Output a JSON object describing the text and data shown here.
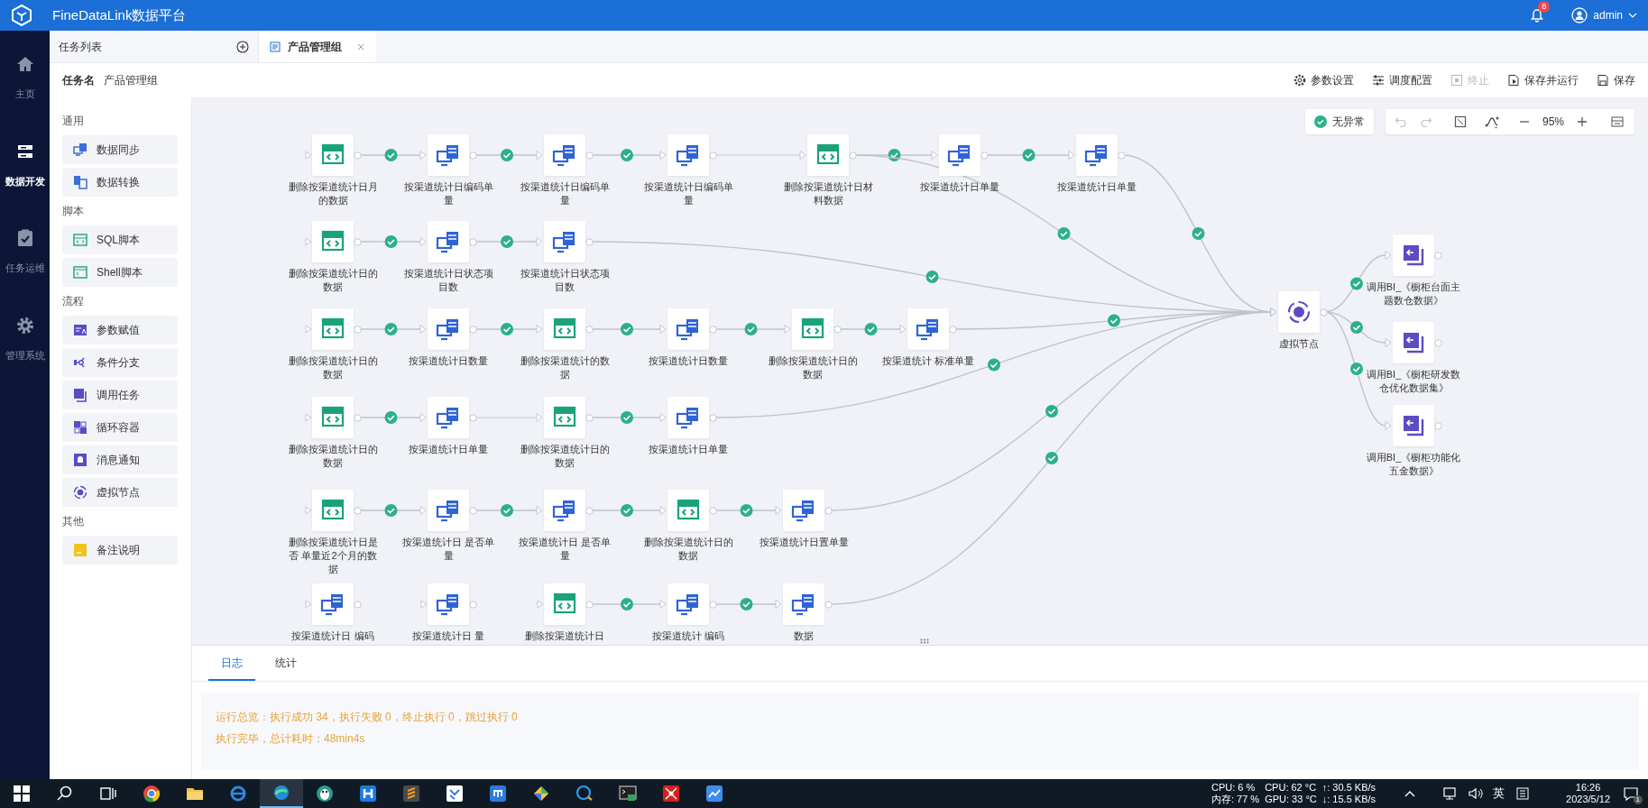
{
  "header": {
    "title": "FineDataLink数据平台",
    "notification_count": "8",
    "user": "admin"
  },
  "nav": [
    {
      "label": "主页",
      "kind": "home",
      "selected": false
    },
    {
      "label": "数据开发",
      "kind": "dev",
      "selected": true
    },
    {
      "label": "任务运维",
      "kind": "ops",
      "selected": false
    },
    {
      "label": "管理系统",
      "kind": "admin",
      "selected": false
    }
  ],
  "task_list": {
    "title": "任务列表"
  },
  "tabs": [
    {
      "label": "产品管理组",
      "selected": true
    }
  ],
  "task_name": {
    "label": "任务名",
    "value": "产品管理组"
  },
  "actions": [
    {
      "label": "参数设置",
      "kind": "settings",
      "disabled": false
    },
    {
      "label": "调度配置",
      "kind": "schedule",
      "disabled": false
    },
    {
      "label": "终止",
      "kind": "stop",
      "disabled": true
    },
    {
      "label": "保存并运行",
      "kind": "save_run",
      "disabled": false
    },
    {
      "label": "保存",
      "kind": "save",
      "disabled": false
    }
  ],
  "palette": [
    {
      "title": "通用",
      "items": [
        {
          "label": "数据同步",
          "kind": "sync"
        },
        {
          "label": "数据转换",
          "kind": "transform"
        }
      ]
    },
    {
      "title": "脚本",
      "items": [
        {
          "label": "SQL脚本",
          "kind": "sql"
        },
        {
          "label": "Shell脚本",
          "kind": "shell"
        }
      ]
    },
    {
      "title": "流程",
      "items": [
        {
          "label": "参数赋值",
          "kind": "param"
        },
        {
          "label": "条件分支",
          "kind": "branch"
        },
        {
          "label": "调用任务",
          "kind": "call"
        },
        {
          "label": "循环容器",
          "kind": "loop"
        },
        {
          "label": "消息通知",
          "kind": "notify"
        },
        {
          "label": "虚拟节点",
          "kind": "virtual"
        }
      ]
    },
    {
      "title": "其他",
      "items": [
        {
          "label": "备注说明",
          "kind": "note"
        }
      ]
    }
  ],
  "canvas": {
    "status": "无异常",
    "zoom": "95%",
    "nodes": [
      {
        "kind": "sql",
        "label": "删除按渠道统计日月的数据"
      },
      {
        "kind": "sync",
        "label": "按渠道统计日编码单量"
      },
      {
        "kind": "sync",
        "label": "按渠道统计日编码单量"
      },
      {
        "kind": "sync",
        "label": "按渠道统计日编码单量"
      },
      {
        "kind": "sql",
        "label": "删除按渠道统计日材料数据"
      },
      {
        "kind": "sync",
        "label": "按渠道统计日单量"
      },
      {
        "kind": "sync",
        "label": "按渠道统计日单量"
      },
      {
        "kind": "sql",
        "label": "删除按渠道统计日的数据"
      },
      {
        "kind": "sync",
        "label": "按渠道统计日状态项目数"
      },
      {
        "kind": "sync",
        "label": "按渠道统计日状态项目数"
      },
      {
        "kind": "sql",
        "label": "删除按渠道统计日的数据"
      },
      {
        "kind": "sync",
        "label": "按渠道统计日数量"
      },
      {
        "kind": "sql",
        "label": "删除按渠道统计的数据"
      },
      {
        "kind": "sync",
        "label": "按渠道统计日数量"
      },
      {
        "kind": "sql",
        "label": "删除按渠道统计日的数据"
      },
      {
        "kind": "sync",
        "label": "按渠道统计 标准单量"
      },
      {
        "kind": "sql",
        "label": "删除按渠道统计日的数据"
      },
      {
        "kind": "sync",
        "label": "按渠道统计日单量"
      },
      {
        "kind": "sql",
        "label": "删除按渠道统计日的数据"
      },
      {
        "kind": "sync",
        "label": "按渠道统计日单量"
      },
      {
        "kind": "sql",
        "label": "删除按渠道统计日是否 单量近2个月的数据"
      },
      {
        "kind": "sync",
        "label": "按渠道统计日 是否单量"
      },
      {
        "kind": "sync",
        "label": "按渠道统计日 是否单量"
      },
      {
        "kind": "sql",
        "label": "删除按渠道统计日的数据"
      },
      {
        "kind": "sync",
        "label": "按渠道统计日置单量"
      },
      {
        "kind": "sync",
        "label": "按渠道统计日 编码"
      },
      {
        "kind": "sync",
        "label": "按渠道统计日 量"
      },
      {
        "kind": "sql",
        "label": "删除按渠道统计日"
      },
      {
        "kind": "sync",
        "label": "按渠道统计 编码"
      },
      {
        "kind": "sync",
        "label": "数据"
      },
      {
        "kind": "virtual",
        "label": "虚拟节点"
      },
      {
        "kind": "call",
        "label": "调用BI_《橱柜台面主题数仓数据》"
      },
      {
        "kind": "call",
        "label": "调用BI_《橱柜研发数仓优化数据集》"
      },
      {
        "kind": "call",
        "label": "调用BI_《橱柜功能化五金数据》"
      }
    ],
    "edges": [
      {
        "succeeded": true
      },
      {
        "succeeded": true
      },
      {
        "succeeded": true
      },
      {
        "succeeded": false
      },
      {
        "succeeded": true
      },
      {
        "succeeded": true
      },
      {
        "succeeded": true
      },
      {
        "succeeded": true
      },
      {
        "succeeded": true
      },
      {
        "succeeded": true
      },
      {
        "succeeded": true
      },
      {
        "succeeded": true
      },
      {
        "succeeded": true
      },
      {
        "succeeded": true
      },
      {
        "succeeded": true
      },
      {
        "succeeded": true
      },
      {
        "succeeded": true
      },
      {
        "succeeded": true
      },
      {
        "succeeded": false
      },
      {
        "succeeded": true
      },
      {
        "succeeded": true
      },
      {
        "succeeded": true
      },
      {
        "succeeded": true
      },
      {
        "succeeded": true
      },
      {
        "succeeded": true
      },
      {
        "succeeded": true
      },
      {
        "succeeded": true
      },
      {
        "succeeded": true
      },
      {
        "succeeded": true
      },
      {
        "succeeded": true
      },
      {
        "succeeded": true
      },
      {
        "succeeded": true
      }
    ]
  },
  "log_panel": {
    "tabs": [
      {
        "label": "日志",
        "selected": true
      },
      {
        "label": "统计",
        "selected": false
      }
    ],
    "lines": [
      "运行总览：执行成功 34，执行失败 0，终止执行 0，跳过执行 0",
      "执行完毕，总计耗时：48min4s"
    ]
  },
  "taskbar": {
    "apps": [
      {
        "kind": "windows",
        "selected": false
      },
      {
        "kind": "search",
        "selected": false
      },
      {
        "kind": "taskview",
        "selected": false
      },
      {
        "kind": "chrome",
        "selected": false
      },
      {
        "kind": "folder",
        "selected": false
      },
      {
        "kind": "ie",
        "selected": false
      },
      {
        "kind": "edge",
        "selected": true
      },
      {
        "kind": "penguin",
        "selected": false
      },
      {
        "kind": "blue",
        "selected": false
      },
      {
        "kind": "orange",
        "selected": false
      },
      {
        "kind": "kanban",
        "selected": false
      },
      {
        "kind": "upload",
        "selected": false
      },
      {
        "kind": "tiles",
        "selected": false
      },
      {
        "kind": "chat",
        "selected": false
      },
      {
        "kind": "terminal",
        "selected": false
      },
      {
        "kind": "network",
        "selected": false
      },
      {
        "kind": "chart",
        "selected": false
      }
    ],
    "monitor": [
      "CPU: 6 %",
      "CPU: 62 °C",
      "↑: 30.5 KB/s",
      "内存: 77 %",
      "GPU: 33 °C",
      "↓: 15.5 KB/s"
    ],
    "ime": "英",
    "time": "16:26",
    "date": "2023/5/12",
    "notifications": "1"
  }
}
